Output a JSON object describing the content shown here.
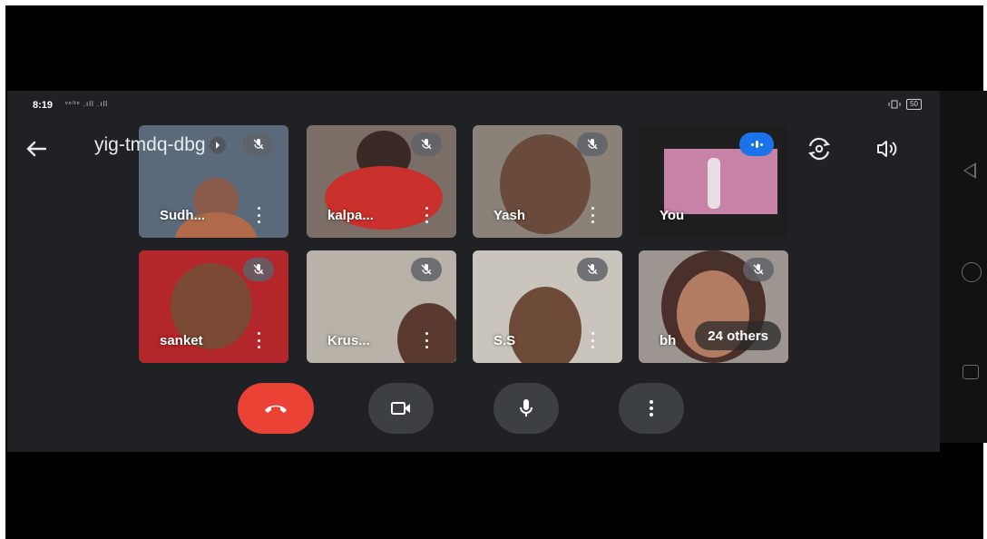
{
  "status_bar": {
    "time": "8:19",
    "network": "ᵛᵒˡᵗᵉ .ıll .ıll",
    "battery": "50"
  },
  "meeting": {
    "code": "yig-tmdq-dbg"
  },
  "icons": {
    "back": "arrow-left-icon",
    "switch_camera": "switch-camera-icon",
    "audio_output": "speaker-icon",
    "end_call": "phone-hangup-icon",
    "camera": "video-camera-icon",
    "microphone": "microphone-icon",
    "more": "more-vertical-icon",
    "muted": "mic-off-icon"
  },
  "participants": [
    {
      "name": "Sudh...",
      "muted": true,
      "bg": "#5b6a7a"
    },
    {
      "name": "kalpa...",
      "muted": true,
      "bg": "#7a6e66"
    },
    {
      "name": "Yash",
      "muted": true,
      "bg": "#8a8278"
    },
    {
      "name": "You",
      "muted": false,
      "bg": "#2a2a2a"
    },
    {
      "name": "sanket",
      "muted": true,
      "bg": "#b3262a"
    },
    {
      "name": "Krus...",
      "muted": true,
      "bg": "#b8b2a8"
    },
    {
      "name": "S.S",
      "muted": true,
      "bg": "#c9c4bc"
    },
    {
      "name": "bh",
      "muted": true,
      "bg": "#9c9590"
    }
  ],
  "others_label": "24 others",
  "colors": {
    "background": "#202124",
    "end_call": "#ea4335",
    "control": "#3c4043",
    "speaking": "#1a73e8"
  }
}
